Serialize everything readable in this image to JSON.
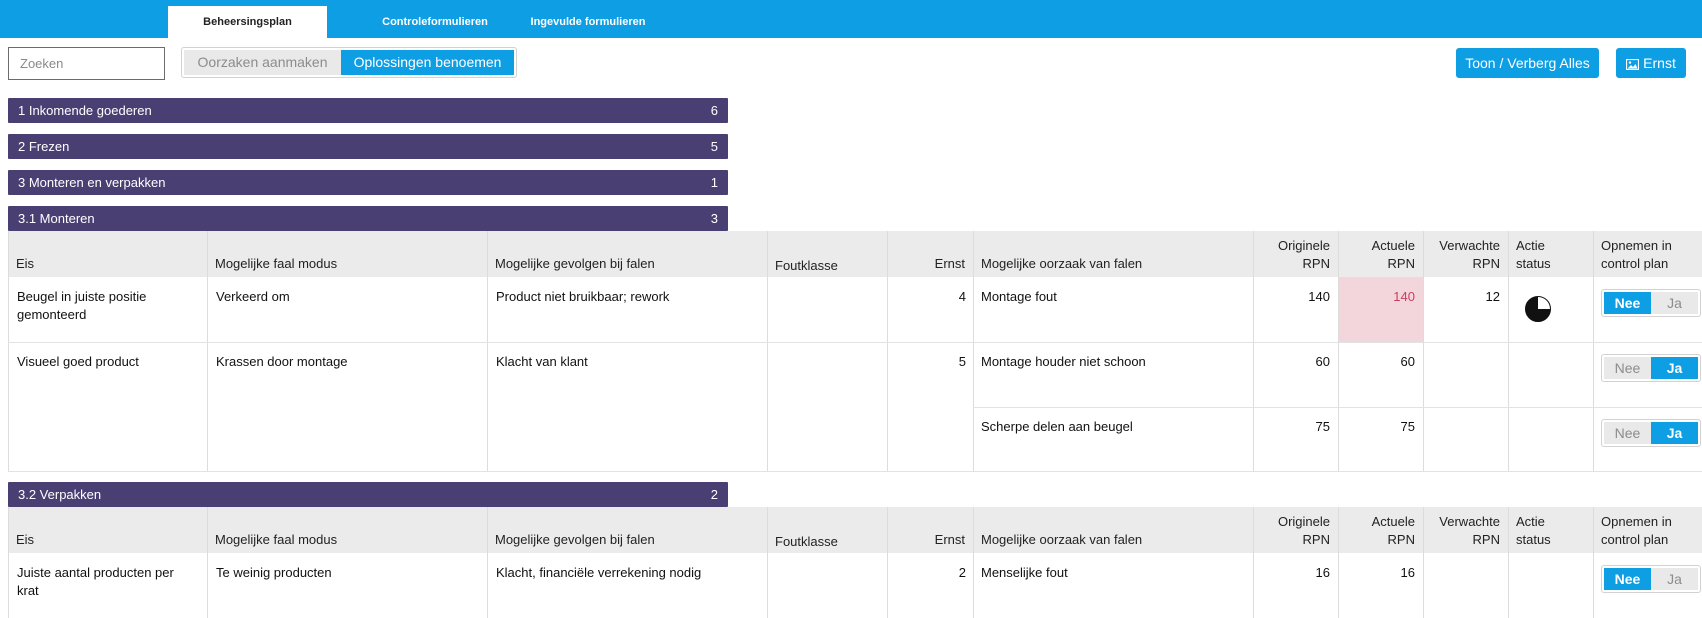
{
  "tabs": [
    {
      "label": "Beheersingsplan",
      "active": true
    },
    {
      "label": "Controleformulieren",
      "active": false
    },
    {
      "label": "Ingevulde formulieren",
      "active": false
    }
  ],
  "search": {
    "placeholder": "Zoeken",
    "value": ""
  },
  "mode_toggle": {
    "off_label": "Oorzaken aanmaken",
    "on_label": "Oplossingen benoemen",
    "selected": "Oplossingen benoemen"
  },
  "toolbar": {
    "show_hide_label": "Toon / Verberg Alles",
    "ernst_label": "Ernst",
    "ernst_icon": "image-icon"
  },
  "groups": [
    {
      "title": "1 Inkomende goederen",
      "count": "6"
    },
    {
      "title": "2 Frezen",
      "count": "5"
    },
    {
      "title": "3 Monteren en verpakken",
      "count": "1"
    },
    {
      "title": "3.1 Monteren",
      "count": "3"
    },
    {
      "title": "3.2 Verpakken",
      "count": "2"
    }
  ],
  "columns": {
    "eis": "Eis",
    "faal_modus": "Mogelijke faal modus",
    "gevolgen": "Mogelijke gevolgen bij falen",
    "foutklasse": "Foutklasse",
    "ernst": "Ernst",
    "oorzaak": "Mogelijke oorzaak van falen",
    "originele_rpn_1": "Originele",
    "originele_rpn_2": "RPN",
    "actuele_rpn_1": "Actuele",
    "actuele_rpn_2": "RPN",
    "verwachte_rpn_1": "Verwachte",
    "verwachte_rpn_2": "RPN",
    "actie_1": "Actie",
    "actie_2": "status",
    "opnemen_1": "Opnemen in",
    "opnemen_2": "control plan"
  },
  "toggle_labels": {
    "nee": "Nee",
    "ja": "Ja"
  },
  "monteren_rows": [
    {
      "eis_1": "Beugel in juiste positie",
      "eis_2": "gemonteerd",
      "faal_modus": "Verkeerd om",
      "gevolgen": "Product niet bruikbaar; rework",
      "foutklasse": "",
      "ernst": "4",
      "oorzaak": "Montage fout",
      "originele_rpn": "140",
      "actuele_rpn": "140",
      "verwachte_rpn": "12",
      "actie_status": "pie-quarter-icon",
      "opnemen": "Nee",
      "highlight_color": "#f2d6dc"
    },
    {
      "eis_1": "Visueel goed product",
      "faal_modus": "Krassen door montage",
      "gevolgen": "Klacht van klant",
      "foutklasse": "",
      "ernst": "5",
      "oorzaak": "Montage houder niet schoon",
      "originele_rpn": "60",
      "actuele_rpn": "60",
      "verwachte_rpn": "",
      "opnemen": "Ja"
    },
    {
      "oorzaak": "Scherpe delen aan beugel",
      "originele_rpn": "75",
      "actuele_rpn": "75",
      "verwachte_rpn": "",
      "opnemen": "Ja"
    }
  ],
  "verpakken_rows": [
    {
      "eis_1": "Juiste aantal producten per",
      "eis_2": "krat",
      "faal_modus": "Te weinig producten",
      "gevolgen": "Klacht, financiële verrekening nodig",
      "foutklasse": "",
      "ernst": "2",
      "oorzaak": "Menselijke fout",
      "originele_rpn": "16",
      "actuele_rpn": "16",
      "verwachte_rpn": "",
      "opnemen": "Nee"
    }
  ],
  "colors": {
    "accent": "#0e9ee4",
    "group_bar": "#4a3f73",
    "header_bg": "#ebebeb",
    "alert_red": "#c9405a"
  }
}
